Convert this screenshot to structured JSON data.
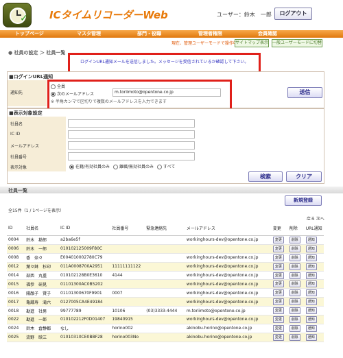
{
  "header": {
    "app_title": "ICタイムリコーダーWeb",
    "user_label": "ユーザー：鈴木　一郎",
    "logout_label": "ログアウト"
  },
  "nav": {
    "items": [
      "トップページ",
      "マスタ管理",
      "部門・役職",
      "管理者権限",
      "会員確認"
    ],
    "mode_message": "現在、管理ユーザーモードで操作中です。",
    "sitemap_label": "サイトマップ表示",
    "switch_label": "一般ユーザーモードに切替"
  },
  "breadcrumb": "● 社員の設定 ＞ 社員一覧",
  "alert": "ログインURL通知メールを送信しました。メッセージを受信されているか確認して下さい。",
  "login_url_panel": {
    "title": "■ログインURL通知",
    "row_label": "通知先",
    "option_all": "全員",
    "option_address": "次のメールアドレス",
    "address_value": "m.toriimoto@opentone.co.jp",
    "hint": "※ 半角カンマで区切りで複数のメールアドレスを入力できます",
    "send_label": "送信"
  },
  "filter_panel": {
    "title": "■表示対象設定",
    "fields": [
      "社員名",
      "IC ID",
      "メールアドレス",
      "社員番号"
    ],
    "target_label": "表示対象",
    "targets": [
      "在籍/有効社員のみ",
      "離職/無効社員のみ",
      "すべて"
    ],
    "search_label": "検索",
    "clear_label": "クリア"
  },
  "list": {
    "title": "社員一覧",
    "new_label": "新規登録",
    "total": "全15件（1 / 1ページを表示）",
    "pager": "戻る 次へ",
    "columns": [
      "ID",
      "社員名",
      "IC ID",
      "社員番号",
      "緊急連絡先",
      "メールアドレス",
      "変更",
      "削除",
      "URL通知"
    ],
    "edit_label": "変更",
    "delete_label": "削除",
    "notify_label": "通知",
    "rows": [
      {
        "id": "0004",
        "name": "鈴木　勘郎",
        "ic": "a2ba6e5f",
        "no": "",
        "tel": "",
        "mail": "workinghours-dev@opentone.co.jp"
      },
      {
        "id": "0006",
        "name": "鈴木　一郎",
        "ic": "010102125009F80C",
        "no": "",
        "tel": "",
        "mail": ""
      },
      {
        "id": "0008",
        "name": "香　奈々",
        "ic": "E004010002780C79",
        "no": "",
        "tel": "",
        "mail": "workinghours-dev@opentone.co.jp"
      },
      {
        "id": "0012",
        "name": "葉々鉢　杉印",
        "ic": "011A0008700A2951",
        "no": "11111111122",
        "tel": "",
        "mail": "workinghours-dev@opentone.co.jp"
      },
      {
        "id": "0014",
        "name": "部西　丸重",
        "ic": "010102128B0E3610",
        "no": "4144",
        "tel": "",
        "mail": "workinghours-dev@opentone.co.jp"
      },
      {
        "id": "0015",
        "name": "福参　研見",
        "ic": "01101300AC0B5202",
        "no": "",
        "tel": "",
        "mail": "workinghours-dev@opentone.co.jp"
      },
      {
        "id": "0016",
        "name": "陽顔子　賢子",
        "ic": "01101300670F9901",
        "no": "0007",
        "tel": "",
        "mail": "workinghours-dev@opentone.co.jp"
      },
      {
        "id": "0017",
        "name": "亀蔵寿　滝六",
        "ic": "0127005CA4E49184",
        "no": "",
        "tel": "",
        "mail": "workinghours-dev@opentone.co.jp"
      },
      {
        "id": "0018",
        "name": "勘進　社男",
        "ic": "99777789",
        "no": "10106",
        "tel": "(03)3333-4444",
        "mail": "m.toriimoto@opentone.co.jp"
      },
      {
        "id": "0022",
        "name": "勘進　一郎",
        "ic": "010102212F0D01407",
        "no": "19840915",
        "tel": "",
        "mail": "workinghours-dev@opentone.co.jp"
      },
      {
        "id": "0024",
        "name": "鈴木　倉静都",
        "ic": "なし",
        "no": "horino002",
        "tel": "",
        "mail": "akinobu.horino@opentone.co.jp"
      },
      {
        "id": "0025",
        "name": "流野　映三",
        "ic": "01010310CE0BBF28",
        "no": "horino003No",
        "tel": "",
        "mail": "akinobu.horino@opentone.co.jp"
      }
    ]
  },
  "colors": {
    "accent_orange": "#e87a0a",
    "alert_red": "#e0201a",
    "link_blue": "#3030c0",
    "row_alt": "#fbf7d6"
  }
}
